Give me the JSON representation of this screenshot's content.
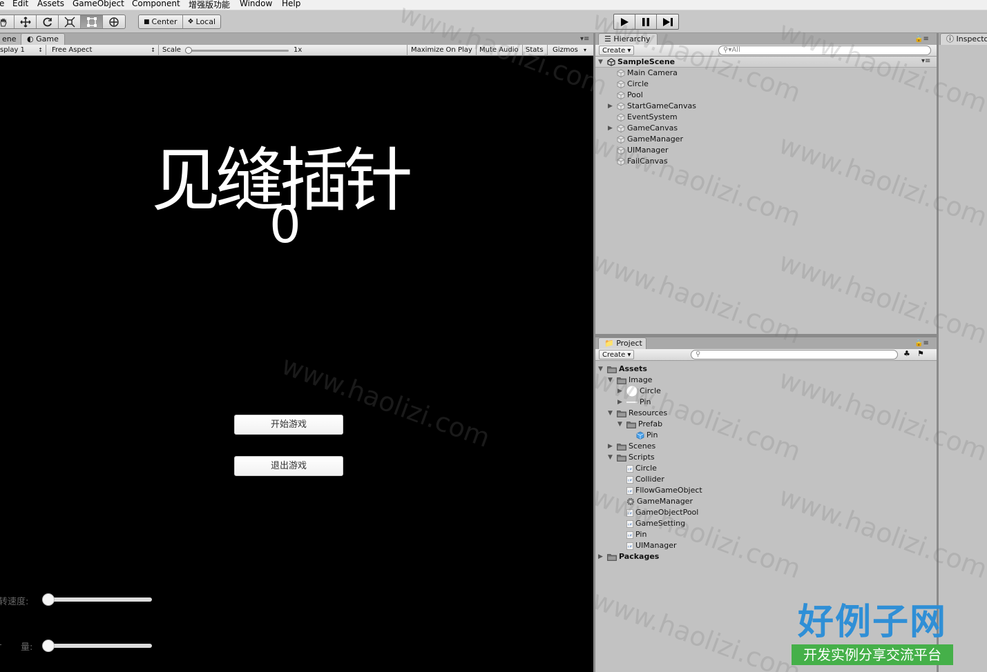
{
  "menu": [
    "e",
    "Edit",
    "Assets",
    "GameObject",
    "Component",
    "增强版功能",
    "Window",
    "Help"
  ],
  "toolbar": {
    "tools": [
      "hand-tool",
      "move-tool",
      "rotate-tool",
      "scale-tool",
      "rect-tool",
      "transform-tool"
    ],
    "pivot_center": "Center",
    "pivot_local": "Local"
  },
  "game_panel": {
    "scene_tab": "ene",
    "game_tab": "Game",
    "display": "splay 1",
    "aspect": "Free Aspect",
    "scale_label": "Scale",
    "scale_value": "1x",
    "maximize": "Maximize On Play",
    "mute": "Mute Audio",
    "stats": "Stats",
    "gizmos": "Gizmos"
  },
  "game": {
    "title": "见缝插针",
    "score": "0",
    "start_button": "开始游戏",
    "quit_button": "退出游戏",
    "slider1_label": "转速度:",
    "slider2_label": "量:",
    "slider2_prefix": "-",
    "slider1_value": 0.0,
    "slider2_value": 0.0
  },
  "hierarchy": {
    "tab": "Hierarchy",
    "create": "Create",
    "search_placeholder": "All",
    "scene": "SampleScene",
    "items": [
      {
        "label": "Main Camera",
        "expandable": false
      },
      {
        "label": "Circle",
        "expandable": false
      },
      {
        "label": "Pool",
        "expandable": false
      },
      {
        "label": "StartGameCanvas",
        "expandable": true
      },
      {
        "label": "EventSystem",
        "expandable": false
      },
      {
        "label": "GameCanvas",
        "expandable": true
      },
      {
        "label": "GameManager",
        "expandable": false
      },
      {
        "label": "UIManager",
        "expandable": false
      },
      {
        "label": "FailCanvas",
        "expandable": false
      }
    ]
  },
  "project": {
    "tab": "Project",
    "create": "Create",
    "tree": [
      {
        "label": "Assets",
        "depth": 0,
        "icon": "folder",
        "arrow": "open",
        "bold": true
      },
      {
        "label": "Image",
        "depth": 1,
        "icon": "folder",
        "arrow": "open"
      },
      {
        "label": "Circle",
        "depth": 2,
        "icon": "circle-sprite",
        "arrow": "closed"
      },
      {
        "label": "Pin",
        "depth": 2,
        "icon": "line-sprite",
        "arrow": "closed"
      },
      {
        "label": "Resources",
        "depth": 1,
        "icon": "folder",
        "arrow": "open"
      },
      {
        "label": "Prefab",
        "depth": 2,
        "icon": "folder",
        "arrow": "open"
      },
      {
        "label": "Pin",
        "depth": 3,
        "icon": "prefab",
        "arrow": "none"
      },
      {
        "label": "Scenes",
        "depth": 1,
        "icon": "folder",
        "arrow": "closed"
      },
      {
        "label": "Scripts",
        "depth": 1,
        "icon": "folder",
        "arrow": "open"
      },
      {
        "label": "Circle",
        "depth": 2,
        "icon": "script",
        "arrow": "none"
      },
      {
        "label": "Collider",
        "depth": 2,
        "icon": "script",
        "arrow": "none"
      },
      {
        "label": "FllowGameObject",
        "depth": 2,
        "icon": "script",
        "arrow": "none"
      },
      {
        "label": "GameManager",
        "depth": 2,
        "icon": "gear",
        "arrow": "none"
      },
      {
        "label": "GameObjectPool",
        "depth": 2,
        "icon": "script",
        "arrow": "none"
      },
      {
        "label": "GameSetting",
        "depth": 2,
        "icon": "script",
        "arrow": "none"
      },
      {
        "label": "Pin",
        "depth": 2,
        "icon": "script",
        "arrow": "none"
      },
      {
        "label": "UIManager",
        "depth": 2,
        "icon": "script",
        "arrow": "none"
      },
      {
        "label": "Packages",
        "depth": 0,
        "icon": "folder",
        "arrow": "closed",
        "bold": true
      }
    ]
  },
  "inspector": {
    "tab": "Inspecto"
  },
  "watermark": {
    "text": "www.haolizi.com",
    "logo_main": "好例子网",
    "logo_sub": "开发实例分享交流平台"
  },
  "colors": {
    "game_bg": "#000000",
    "editor_bg": "#c2c2c2",
    "logo_blue": "#2f8fd6",
    "logo_green": "#45b049"
  }
}
